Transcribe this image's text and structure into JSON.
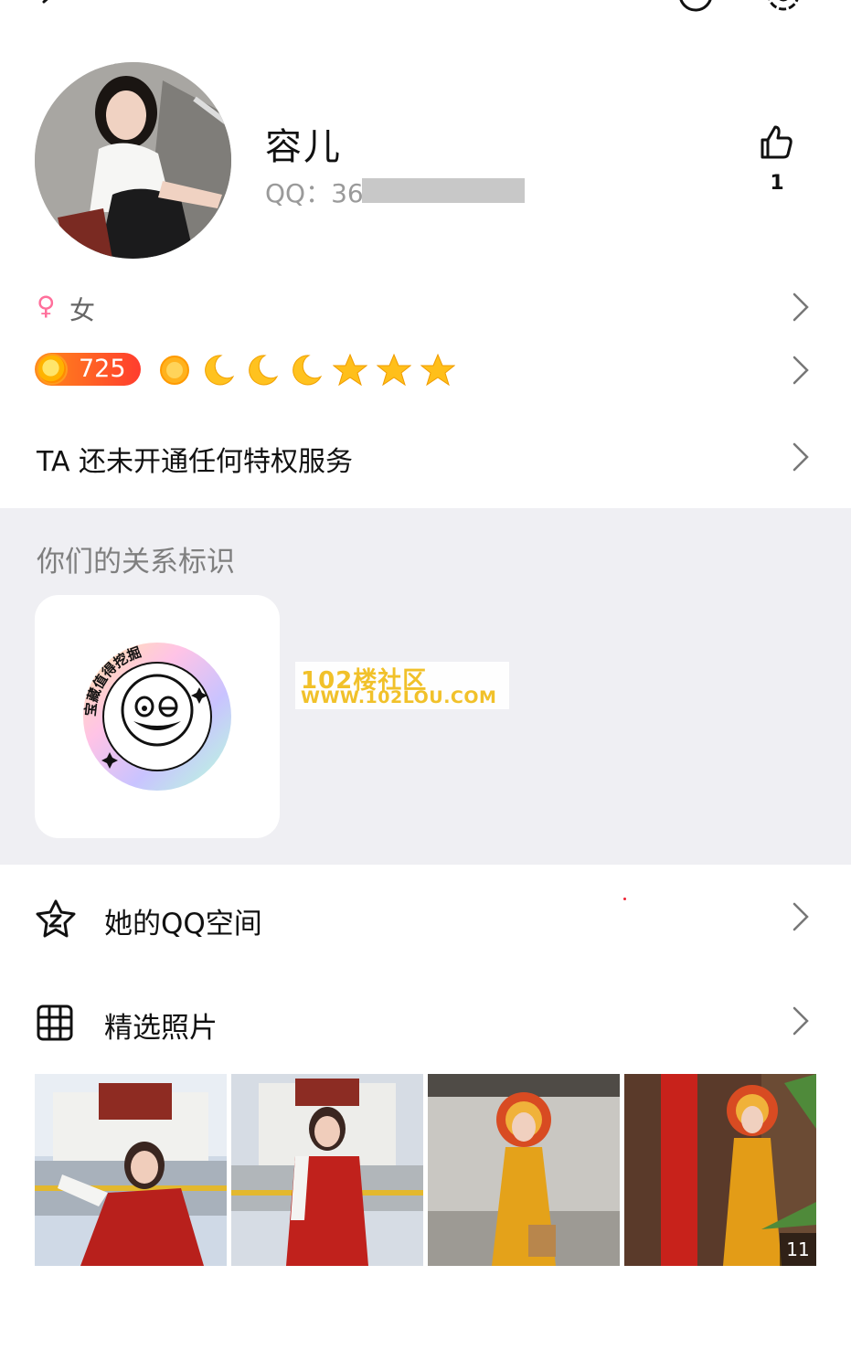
{
  "profile": {
    "name": "容儿",
    "qq_prefix": "QQ：36",
    "like_count": "1",
    "gender": "女",
    "level_number": "725",
    "privilege_text": "TA 还未开通任何特权服务"
  },
  "icons": {
    "back": "back-arrow-icon",
    "contact": "contact-icon",
    "settings": "settings-icon",
    "like": "thumbs-up-icon",
    "gender": "female-icon",
    "level_icons": [
      "sun-icon",
      "moon-icon",
      "moon-icon",
      "moon-icon",
      "star-icon",
      "star-icon",
      "star-icon"
    ]
  },
  "relation": {
    "title": "你们的关系标识",
    "badge_text": "宝藏值得挖掘"
  },
  "watermark": {
    "line1": "102楼社区",
    "line2": "WWW.102LOU.COM"
  },
  "menu": {
    "qzone_label": "她的QQ空间",
    "photos_label": "精选照片"
  },
  "photos": {
    "count_badge": "11"
  },
  "colors": {
    "section_bg": "#efeff3",
    "gender_pink": "#ff6f9b",
    "level_orange": "#ff5a24",
    "watermark_yellow": "#f1c12a"
  }
}
